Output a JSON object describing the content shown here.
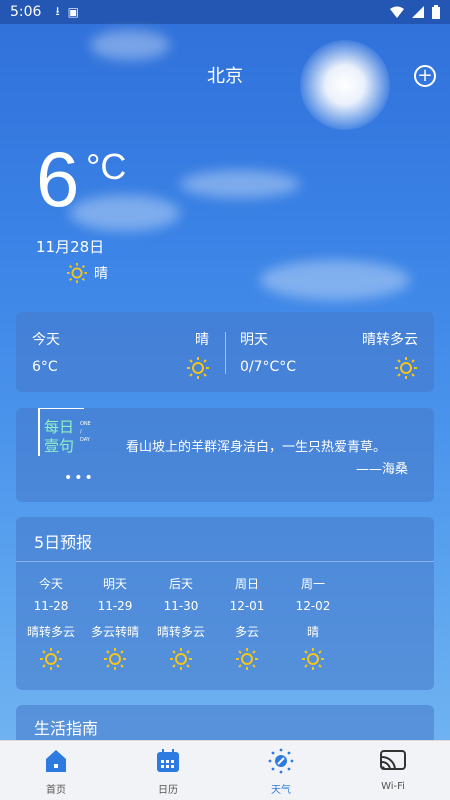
{
  "status_bar": {
    "time": "5:06"
  },
  "header": {
    "city": "北京",
    "add_icon": "add-circle-icon"
  },
  "current": {
    "temp": "6",
    "unit": "°C",
    "date": "11月28日",
    "condition": "晴"
  },
  "today_tomorrow": {
    "today": {
      "label": "今天",
      "condition": "晴",
      "range": "6°C"
    },
    "tomorrow": {
      "label": "明天",
      "condition": "晴转多云",
      "range": "0/7°C°C"
    }
  },
  "quote": {
    "badge_line1": "每日",
    "badge_line2": "壹句",
    "badge_small1": "ONE",
    "badge_small2": "/",
    "badge_small3": "DAY",
    "text": "看山坡上的羊群浑身洁白，一生只热爱青草。",
    "author": "——海桑",
    "dots": "•••"
  },
  "forecast": {
    "title": "5日预报",
    "days": [
      {
        "day": "今天",
        "date": "11-28",
        "condition": "晴转多云"
      },
      {
        "day": "明天",
        "date": "11-29",
        "condition": "多云转晴"
      },
      {
        "day": "后天",
        "date": "11-30",
        "condition": "晴转多云"
      },
      {
        "day": "周日",
        "date": "12-01",
        "condition": "多云"
      },
      {
        "day": "周一",
        "date": "12-02",
        "condition": "晴"
      }
    ]
  },
  "life": {
    "title": "生活指南"
  },
  "tabs": [
    {
      "label": "首页",
      "icon": "home-icon"
    },
    {
      "label": "日历",
      "icon": "calendar-icon"
    },
    {
      "label": "天气",
      "icon": "weather-icon"
    },
    {
      "label": "Wi-Fi",
      "icon": "wifi-cast-icon"
    }
  ],
  "colors": {
    "accent": "#2d7be0",
    "sun": "#f5c518"
  }
}
